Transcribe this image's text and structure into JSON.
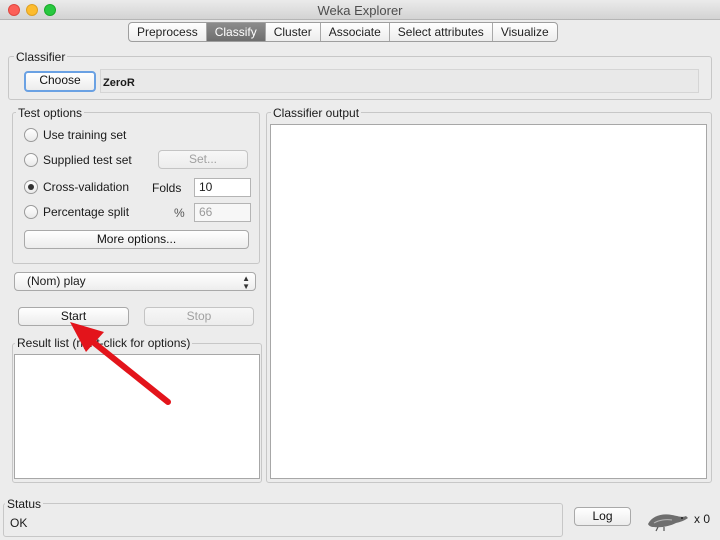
{
  "window": {
    "title": "Weka Explorer"
  },
  "tabs": [
    {
      "label": "Preprocess"
    },
    {
      "label": "Classify",
      "active": true
    },
    {
      "label": "Cluster"
    },
    {
      "label": "Associate"
    },
    {
      "label": "Select attributes"
    },
    {
      "label": "Visualize"
    }
  ],
  "classifier": {
    "group_label": "Classifier",
    "choose_label": "Choose",
    "name": "ZeroR"
  },
  "test_options": {
    "group_label": "Test options",
    "use_training_set": "Use training set",
    "supplied_test_set": "Supplied test set",
    "set_label": "Set...",
    "cross_validation": "Cross-validation",
    "folds_label": "Folds",
    "folds_value": "10",
    "percentage_split": "Percentage split",
    "percent_symbol": "%",
    "percent_value": "66",
    "more_options": "More options...",
    "selected": "cross_validation"
  },
  "class_select": {
    "value": "(Nom) play"
  },
  "actions": {
    "start": "Start",
    "stop": "Stop"
  },
  "result_list": {
    "label": "Result list (right-click for options)"
  },
  "output": {
    "label": "Classifier output"
  },
  "status": {
    "label": "Status",
    "text": "OK"
  },
  "log": {
    "label": "Log",
    "count": "x 0"
  },
  "colors": {
    "annotation_arrow": "#e3141b",
    "active_tab": "#7d7d7d"
  }
}
